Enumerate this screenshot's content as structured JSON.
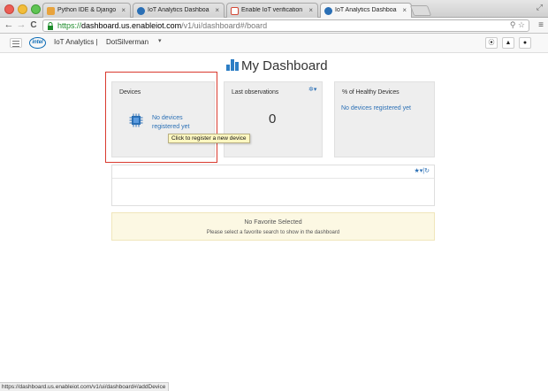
{
  "browser": {
    "tabs": [
      {
        "title": "Python IDE & Django IDE fo",
        "close": "×",
        "favicon_color": "#e8a33d"
      },
      {
        "title": "IoT Analytics Dashboard",
        "close": "×",
        "favicon_color": "#2a6fb5"
      },
      {
        "title": "Enable IoT verification - u",
        "close": "×",
        "favicon_color": "#d34836"
      },
      {
        "title": "IoT Analytics Dashboard",
        "close": "×",
        "favicon_color": "#2a6fb5",
        "active": true
      }
    ],
    "url": {
      "scheme": "https://",
      "host": "dashboard.us.enableiot.com",
      "path": "/v1/ui/dashboard#/board"
    },
    "nav": {
      "back": "←",
      "forward": "→",
      "reload": "C"
    },
    "menu_icon": "≡",
    "status_url": "https://dashboard.us.enableiot.com/v1/ui/dashboard#/addDevice"
  },
  "header": {
    "logo": "intel",
    "brand": "IoT Analytics |",
    "account": "DotSilverman",
    "account_caret": "▾",
    "right_buttons": [
      {
        "icon": "chat-bubble-icon",
        "glyph": "⦿"
      },
      {
        "icon": "bell-icon",
        "glyph": "▲"
      },
      {
        "icon": "user-icon",
        "glyph": "●"
      }
    ]
  },
  "page": {
    "title": "My Dashboard",
    "cards": [
      {
        "title": "Devices",
        "link": "No devices registered yet",
        "link_line1": "No devices",
        "link_line2": "registered yet"
      },
      {
        "title": "Last observations",
        "value": "0",
        "settings": "✲▾"
      },
      {
        "title": "% of Healthy Devices",
        "link": "No devices registered yet"
      }
    ],
    "tooltip": "Click to register a new device",
    "panel_tools": "★▾|↻",
    "favorites": {
      "title": "No Favorite Selected",
      "subtitle": "Please select a favorite search to show in the dashboard"
    }
  },
  "colors": {
    "accent": "#2a6fb5",
    "highlight": "#d93a2f",
    "tooltip_bg": "#fdf7c1",
    "warning_bg": "#fcf8e3"
  }
}
